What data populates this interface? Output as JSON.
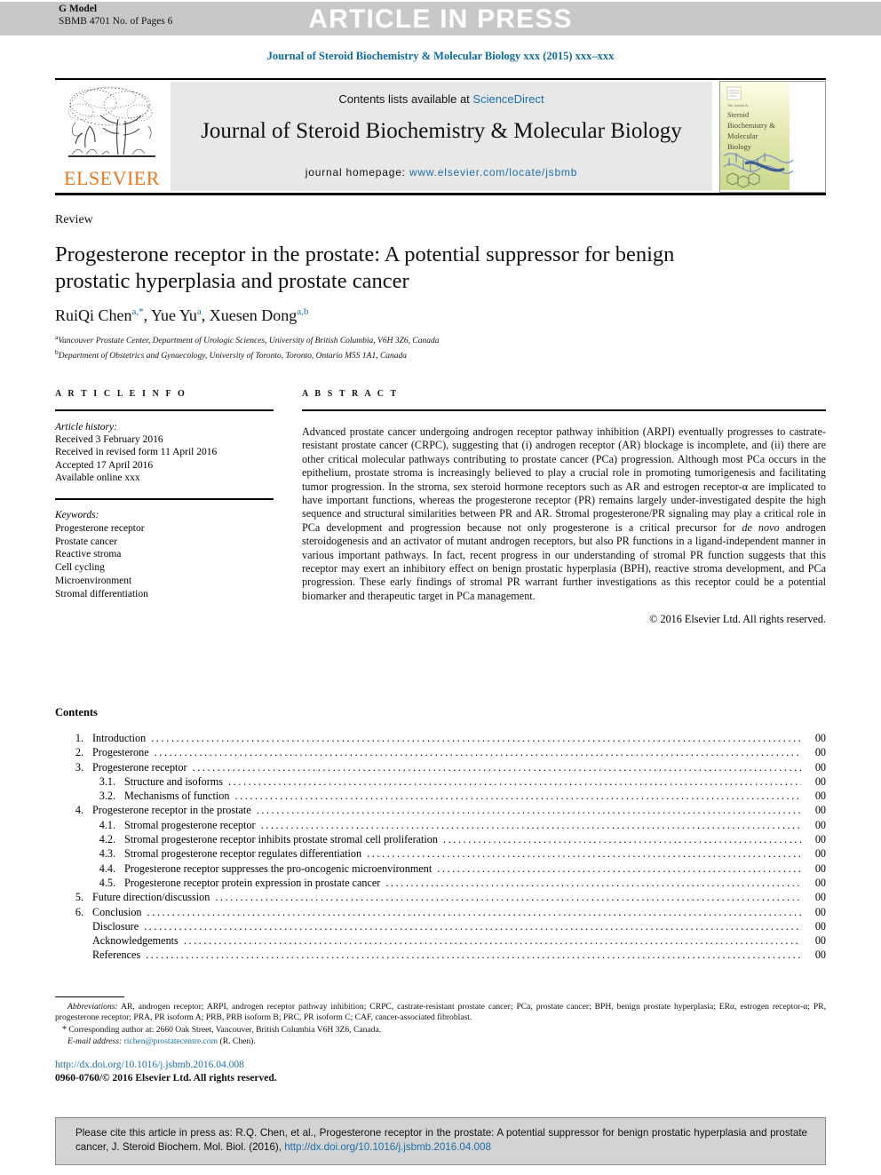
{
  "header": {
    "g_model_label": "G Model",
    "g_model_id": "SBMB 4701 No. of Pages 6",
    "banner": "ARTICLE IN PRESS",
    "running_head": "Journal of Steroid Biochemistry & Molecular Biology xxx (2015) xxx–xxx",
    "banner_bg": "#c8c8c8",
    "banner_text_color": "#ffffff"
  },
  "masthead": {
    "publisher": "ELSEVIER",
    "publisher_color": "#E87722",
    "contents_prefix": "Contents lists available at ",
    "contents_link": "ScienceDirect",
    "journal_title": "Journal of Steroid Biochemistry & Molecular Biology",
    "homepage_prefix": "journal homepage: ",
    "homepage_link": "www.elsevier.com/locate/jsbmb",
    "link_color": "#1c6fa8",
    "cover_title_lines": [
      "Steroid",
      "Biochemistry &",
      "Molecular",
      "Biology"
    ]
  },
  "article": {
    "type": "Review",
    "title": "Progesterone receptor in the prostate: A potential suppressor for benign prostatic hyperplasia and prostate cancer",
    "authors": [
      {
        "name": "RuiQi Chen",
        "marks": "a,*"
      },
      {
        "name": "Yue Yu",
        "marks": "a"
      },
      {
        "name": "Xuesen Dong",
        "marks": "a,b"
      }
    ],
    "affiliations": [
      {
        "mark": "a",
        "text": "Vancouver Prostate Center, Department of Urologic Sciences, University of British Columbia, V6H 3Z6, Canada"
      },
      {
        "mark": "b",
        "text": "Department of Obstetrics and Gynaecology, University of Toronto, Toronto, Ontario M5S 1A1, Canada"
      }
    ]
  },
  "info": {
    "heading": "A R T I C L E   I N F O",
    "history_label": "Article history:",
    "history": [
      "Received 3 February 2016",
      "Received in revised form 11 April 2016",
      "Accepted 17 April 2016",
      "Available online xxx"
    ],
    "keywords_label": "Keywords:",
    "keywords": [
      "Progesterone receptor",
      "Prostate cancer",
      "Reactive stroma",
      "Cell cycling",
      "Microenvironment",
      "Stromal differentiation"
    ]
  },
  "abstract": {
    "heading": "A B S T R A C T",
    "part1": "Advanced prostate cancer undergoing androgen receptor pathway inhibition (ARPI) eventually progresses to castrate-resistant prostate cancer (CRPC), suggesting that (i) androgen receptor (AR) blockage is incomplete, and (ii) there are other critical molecular pathways contributing to prostate cancer (PCa) progression. Although most PCa occurs in the epithelium, prostate stroma is increasingly believed to play a crucial role in promoting tumorigenesis and facilitating tumor progression. In the stroma, sex steroid hormone receptors such as AR and estrogen receptor-α are implicated to have important functions, whereas the progesterone receptor (PR) remains largely under-investigated despite the high sequence and structural similarities between PR and AR. Stromal progesterone/PR signaling may play a critical role in PCa development and progression because not only progesterone is a critical precursor for ",
    "italic1": "de novo",
    "part2": " androgen steroidogenesis and an activator of mutant androgen receptors, but also PR functions in a ligand-independent manner in various important pathways. In fact, recent progress in our understanding of stromal PR function suggests that this receptor may exert an inhibitory effect on benign prostatic hyperplasia (BPH), reactive stroma development, and PCa progression. These early findings of stromal PR warrant further investigations as this receptor could be a potential biomarker and therapeutic target in PCa management.",
    "copyright": "© 2016 Elsevier Ltd. All rights reserved."
  },
  "contents": {
    "heading": "Contents",
    "items": [
      {
        "num": "1.",
        "label": "Introduction",
        "page": "00",
        "sub": false
      },
      {
        "num": "2.",
        "label": "Progesterone",
        "page": "00",
        "sub": false
      },
      {
        "num": "3.",
        "label": "Progesterone receptor",
        "page": "00",
        "sub": false
      },
      {
        "num": "3.1.",
        "label": "Structure and isoforms",
        "page": "00",
        "sub": true
      },
      {
        "num": "3.2.",
        "label": "Mechanisms of function",
        "page": "00",
        "sub": true
      },
      {
        "num": "4.",
        "label": "Progesterone receptor in the prostate",
        "page": "00",
        "sub": false
      },
      {
        "num": "4.1.",
        "label": "Stromal progesterone receptor",
        "page": "00",
        "sub": true
      },
      {
        "num": "4.2.",
        "label": "Stromal progesterone receptor inhibits prostate stromal cell proliferation",
        "page": "00",
        "sub": true
      },
      {
        "num": "4.3.",
        "label": "Stromal progesterone receptor regulates differentiation",
        "page": "00",
        "sub": true
      },
      {
        "num": "4.4.",
        "label": "Progesterone receptor suppresses the pro-oncogenic microenvironment",
        "page": "00",
        "sub": true
      },
      {
        "num": "4.5.",
        "label": "Progesterone receptor protein expression in prostate cancer",
        "page": "00",
        "sub": true
      },
      {
        "num": "5.",
        "label": "Future direction/discussion",
        "page": "00",
        "sub": false
      },
      {
        "num": "6.",
        "label": "Conclusion",
        "page": "00",
        "sub": false
      },
      {
        "num": "",
        "label": "Disclosure",
        "page": "00",
        "sub": false
      },
      {
        "num": "",
        "label": "Acknowledgements",
        "page": "00",
        "sub": false
      },
      {
        "num": "",
        "label": "References",
        "page": "00",
        "sub": false
      }
    ]
  },
  "footnotes": {
    "abbr_label": "Abbreviations:",
    "abbr_text": " AR, androgen receptor; ARPI, androgen receptor pathway inhibition; CRPC, castrate-resistant prostate cancer; PCa, prostate cancer; BPH, benign prostate hyperplasia; ERα, estrogen receptor-α; PR, progesterone receptor; PRA, PR isoform A; PRB, PRB isoform B; PRC, PR isoform C; CAF, cancer-associated fibroblast.",
    "corresponding": "Corresponding author at: 2660 Oak Street, Vancouver, British Columbia V6H 3Z6, Canada.",
    "email_label": "E-mail address:",
    "email": "richen@prostatecentre.com",
    "email_suffix": " (R. Chen)."
  },
  "footer": {
    "doi": "http://dx.doi.org/10.1016/j.jsbmb.2016.04.008",
    "issn_line": "0960-0760/© 2016 Elsevier Ltd. All rights reserved."
  },
  "cite_box": {
    "text_before": "Please cite this article in press as: R.Q. Chen, et al., Progesterone receptor in the prostate: A potential suppressor for benign prostatic hyperplasia and prostate cancer, J. Steroid Biochem. Mol. Biol. (2016), ",
    "link": "http://dx.doi.org/10.1016/j.jsbmb.2016.04.008",
    "bg": "#d3d3d3"
  }
}
